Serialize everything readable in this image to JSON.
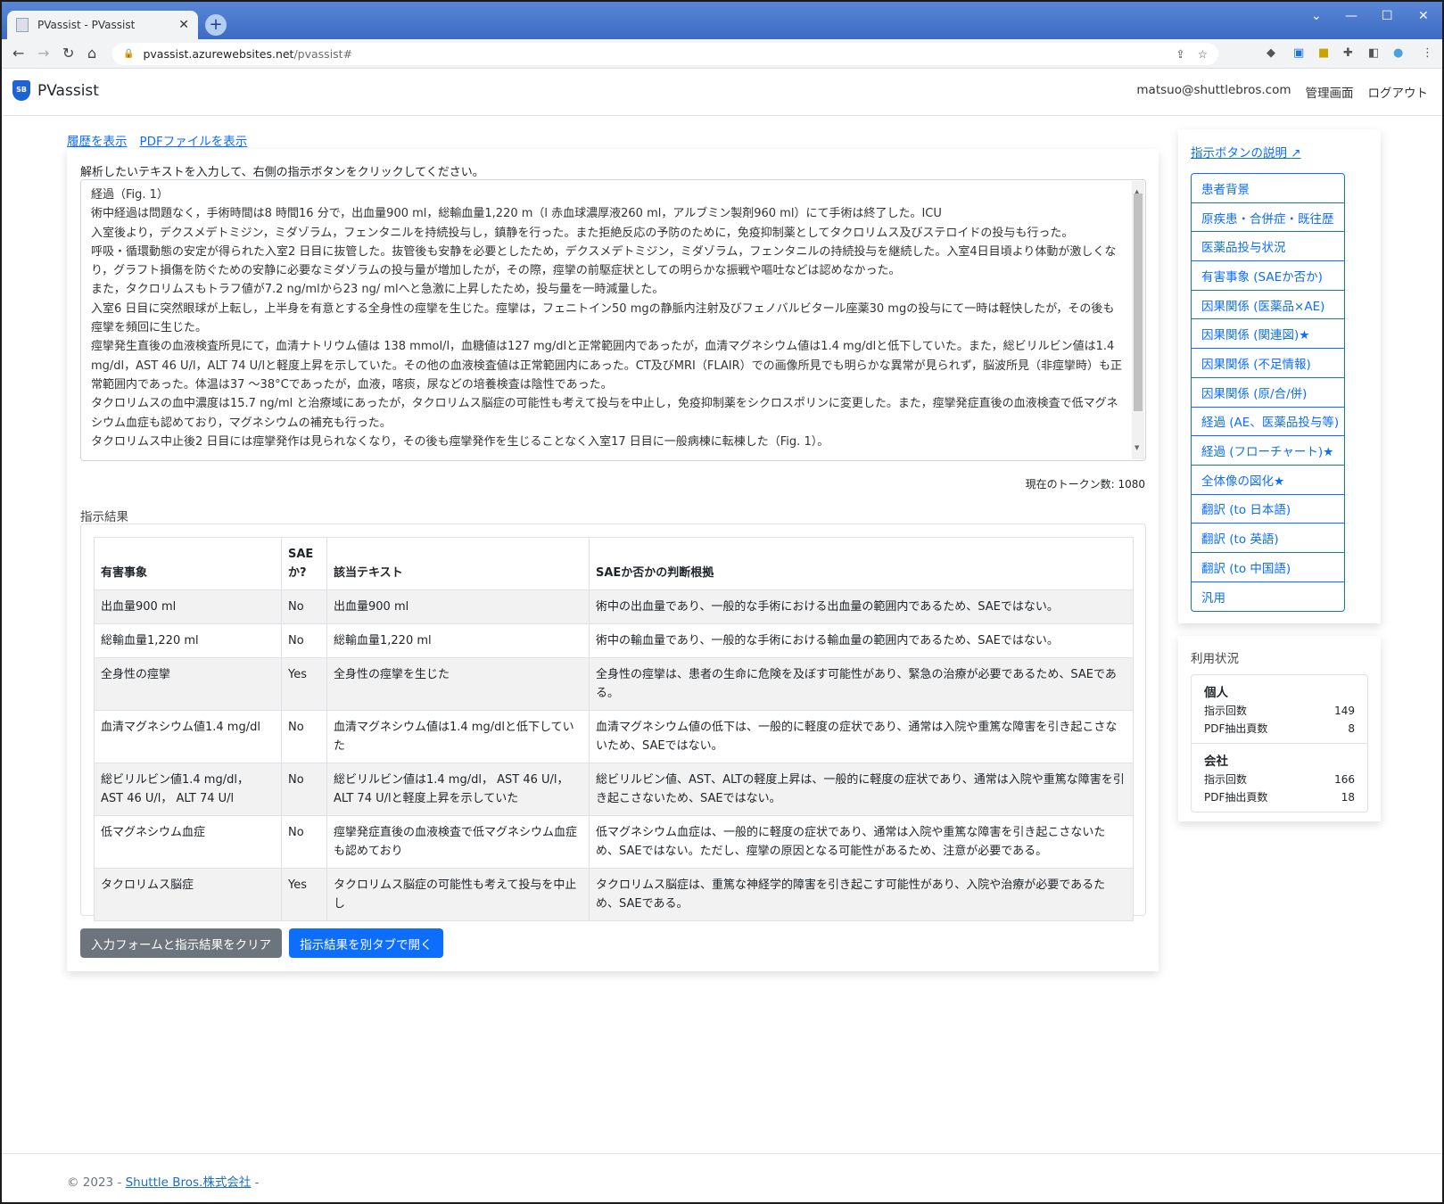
{
  "browser": {
    "tab_title": "PVassist - PVassist",
    "url_host": "pvassist.azurewebsites.net",
    "url_path": "/pvassist#"
  },
  "navbar": {
    "brand": "PVassist",
    "logo_text": "SB",
    "user": "matsuo@shuttlebros.com",
    "admin": "管理画面",
    "logout": "ログアウト"
  },
  "links": {
    "history": "履歴を表示",
    "pdf": "PDFファイルを表示"
  },
  "input": {
    "instruction": "解析したいテキストを入力して、右側の指示ボタンをクリックしてください。",
    "text": "経過（Fig. 1）\n術中経過は問題なく，手術時間は8 時間16 分で，出血量900 ml，総輸血量1,220 m（l 赤血球濃厚液260 ml，アルブミン製剤960 ml）にて手術は終了した。ICU\n入室後より，デクスメデトミジン，ミダゾラム，フェンタニルを持続投与し，鎮静を行った。また拒絶反応の予防のために，免疫抑制薬としてタクロリムス及びステロイドの投与も行った。\n呼吸・循環動態の安定が得られた入室2 日目に抜管した。抜管後も安静を必要としたため，デクスメデトミジン，ミダゾラム，フェンタニルの持続投与を継続した。入室4日目頃より体動が激しくなり，グラフト損傷を防ぐための安静に必要なミダゾラムの投与量が増加したが，その際，痙攣の前駆症状としての明らかな振戦や嘔吐などは認めなかった。\nまた，タクロリムスもトラフ値が7.2 ng/mlから23 ng/ mlへと急激に上昇したため，投与量を一時減量した。\n入室6 日目に突然眼球が上転し，上半身を有意とする全身性の痙攣を生じた。痙攣は，フェニトイン50 mgの静脈内注射及びフェノバルビタール座薬30 mgの投与にて一時は軽快したが，その後も痙攣を頻回に生じた。\n痙攣発生直後の血液検査所見にて，血清ナトリウム値は 138 mmol/l，血糖値は127 mg/dlと正常範囲内であったが，血清マグネシウム値は1.4 mg/dlと低下していた。また，総ビリルビン値は1.4 mg/dl，AST 46 U/l，ALT 74 U/lと軽度上昇を示していた。その他の血液検査値は正常範囲内にあった。CT及びMRI（FLAIR）での画像所見でも明らかな異常が見られず，脳波所見（非痙攣時）も正常範囲内であった。体温は37 ～38°Cであったが，血液，喀痰，尿などの培養検査は陰性であった。\nタクロリムスの血中濃度は15.7 ng/ml と治療域にあったが，タクロリムス脳症の可能性も考えて投与を中止し，免疫抑制薬をシクロスポリンに変更した。また，痙攣発症直後の血液検査で低マグネシウム血症も認めており，マグネシウムの補充も行った。\nタクロリムス中止後2 日目には痙攣発作は見られなくなり，その後も痙攣発作を生じることなく入室17 日目に一般病棟に転棟した（Fig. 1）。",
    "token_count": "現在のトークン数: 1080"
  },
  "results": {
    "label": "指示結果",
    "headers": [
      "有害事象",
      "SAEか?",
      "該当テキスト",
      "SAEか否かの判断根拠"
    ],
    "rows": [
      [
        "出血量900 ml",
        "No",
        "出血量900 ml",
        "術中の出血量であり、一般的な手術における出血量の範囲内であるため、SAEではない。"
      ],
      [
        "総輸血量1,220 ml",
        "No",
        "総輸血量1,220 ml",
        "術中の輸血量であり、一般的な手術における輸血量の範囲内であるため、SAEではない。"
      ],
      [
        "全身性の痙攣",
        "Yes",
        "全身性の痙攣を生じた",
        "全身性の痙攣は、患者の生命に危険を及ぼす可能性があり、緊急の治療が必要であるため、SAEである。"
      ],
      [
        "血清マグネシウム値1.4 mg/dl",
        "No",
        "血清マグネシウム値は1.4 mg/dlと低下していた",
        "血清マグネシウム値の低下は、一般的に軽度の症状であり、通常は入院や重篤な障害を引き起こさないため、SAEではない。"
      ],
      [
        "総ビリルビン値1.4 mg/dl， AST 46 U/l， ALT 74 U/l",
        "No",
        "総ビリルビン値は1.4 mg/dl， AST 46 U/l， ALT 74 U/lと軽度上昇を示していた",
        "総ビリルビン値、AST、ALTの軽度上昇は、一般的に軽度の症状であり、通常は入院や重篤な障害を引き起こさないため、SAEではない。"
      ],
      [
        "低マグネシウム血症",
        "No",
        "痙攣発症直後の血液検査で低マグネシウム血症も認めており",
        "低マグネシウム血症は、一般的に軽度の症状であり、通常は入院や重篤な障害を引き起こさないため、SAEではない。ただし、痙攣の原因となる可能性があるため、注意が必要である。"
      ],
      [
        "タクロリムス脳症",
        "Yes",
        "タクロリムス脳症の可能性も考えて投与を中止し",
        "タクロリムス脳症は、重篤な神経学的障害を引き起こす可能性があり、入院や治療が必要であるため、SAEである。"
      ]
    ]
  },
  "buttons": {
    "clear": "入力フォームと指示結果をクリア",
    "open_tab": "指示結果を別タブで開く"
  },
  "sidebar": {
    "help_link": "指示ボタンの説明",
    "items": [
      "患者背景",
      "原疾患・合併症・既往歴",
      "医薬品投与状況",
      "有害事象 (SAEか否か)",
      "因果関係 (医薬品×AE)",
      "因果関係 (関連図)★",
      "因果関係 (不足情報)",
      "因果関係 (原/合/併)",
      "経過 (AE、医薬品投与等)",
      "経過 (フローチャート)★",
      "全体像の図化★",
      "翻訳 (to 日本語)",
      "翻訳 (to 英語)",
      "翻訳 (to 中国語)",
      "汎用"
    ]
  },
  "usage": {
    "title": "利用状況",
    "groups": [
      {
        "name": "個人",
        "rows": [
          {
            "label": "指示回数",
            "value": "149"
          },
          {
            "label": "PDF抽出頁数",
            "value": "8"
          }
        ]
      },
      {
        "name": "会社",
        "rows": [
          {
            "label": "指示回数",
            "value": "166"
          },
          {
            "label": "PDF抽出頁数",
            "value": "18"
          }
        ]
      }
    ]
  },
  "footer": {
    "copyright": "© 2023 -",
    "company": "Shuttle Bros.株式会社",
    "suffix": "-"
  },
  "colors": {
    "primary": "#0d6efd",
    "secondary": "#6c757d",
    "titlebar": "#3c6bc4"
  }
}
